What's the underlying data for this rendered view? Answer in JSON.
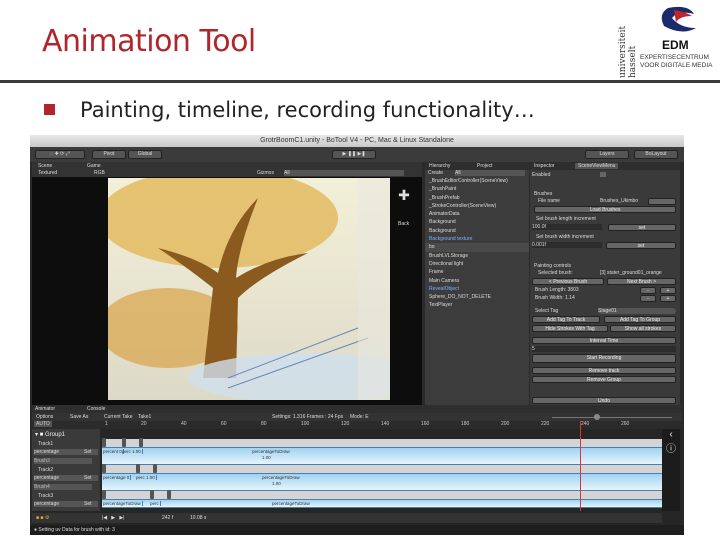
{
  "slide": {
    "title": "Animation Tool",
    "bullet": "Painting, timeline, recording functionality…",
    "logo": {
      "university": "universiteit hasselt",
      "edm": "EDM",
      "line1": "EXPERTISECENTRUM",
      "line2": "VOOR DIGITALE MEDIA"
    }
  },
  "window": {
    "title": "GrotrBoomC1.unity - BoTool V4 - PC, Mac & Linux Standalone",
    "toolbar": {
      "pivot": "Pivot",
      "global": "Global",
      "layers": "Layers",
      "layout": "BoLayout"
    },
    "scene": {
      "tab_scene": "Scene",
      "tab_game": "Game",
      "shading": "Textured",
      "mode": "RGB",
      "gizmos": "Gizmos",
      "search": "All",
      "back": "Back"
    },
    "hierarchy": {
      "tab": "Hierarchy",
      "tab_project": "Project",
      "create": "Create",
      "search": "All",
      "items": [
        "_BrushEditorController(SceneView)",
        "_BrushPaint",
        "_BrushPrefab",
        "_StrokeController(SceneView)",
        "AnimatorData",
        "Background",
        "Background",
        "Background texture",
        "bo",
        "BrushLVLStorage",
        "Directional light",
        "Frame",
        "Main Camera",
        "RevealObject",
        "Sphere_DO_NOT_DELETE",
        "TestPlayer"
      ]
    },
    "inspector": {
      "tab": "Inspector",
      "tab2": "SceneViewMenu",
      "enabled": "Enabled",
      "brushes": "Brushes",
      "file_name_label": "File name",
      "file_name": "Brushes_Ukimbo",
      "load": "Load Brushes",
      "len_label": "Set brush length increment",
      "len_value": "100.0f",
      "set": "set",
      "width_label": "Set brush width increment",
      "width_value": "0.001f",
      "painting": "Painting controls",
      "selected_label": "Selected brush:",
      "selected": "[3] stater_ground01_orange",
      "prev": "< Previous Brush",
      "next": "Next Brush >",
      "brush_length": "Brush Length: 3803",
      "brush_width": "Brush Width: 1.14",
      "minus": "-",
      "plus": "+",
      "select_tag": "Select Tag",
      "tag_value": "Stage01",
      "add_track": "Add Tag To Track",
      "add_group": "Add Tag To Group",
      "hide": "Hide Strokes With Tag",
      "show": "Show all strokes",
      "interval": "Interval Time",
      "interval_value": "5",
      "start": "Start Recording",
      "remove_track": "Remove track",
      "remove_group": "Remove Group",
      "undo": "Undo"
    },
    "animator": {
      "tab": "Animator",
      "tab_console": "Console",
      "menu": [
        "Options",
        "Save As",
        "Current Take",
        "Take1"
      ],
      "info": "Settings: 1.316 Frames : 24 Fps",
      "mode": "Mode: E",
      "auto": "AUTO",
      "ruler": [
        "1",
        "20",
        "40",
        "60",
        "80",
        "100",
        "120",
        "140",
        "160",
        "180",
        "200",
        "220",
        "240",
        "260"
      ],
      "group": "Group1",
      "tracks": [
        {
          "name": "Track1",
          "prop": "percentage",
          "set": "Set",
          "obj": "Brush3",
          "clips": [
            "percent 0",
            "perc 1.00"
          ],
          "long": "percentageToDraw",
          "long_val": "1.00"
        },
        {
          "name": "Track2",
          "prop": "percentage",
          "set": "Set",
          "obj": "Brush4",
          "clips": [
            "percentage 0",
            "perc 1.00"
          ],
          "long": "percentageToDraw",
          "long_val": "1.00"
        },
        {
          "name": "Track3",
          "prop": "percentage",
          "set": "Set",
          "obj": "",
          "clips": [
            "percentageToDraw",
            "perc"
          ],
          "long": "percentageToDraw",
          "long_val": ""
        }
      ],
      "frame": "242 f",
      "time": "10.08 s",
      "playhead": 240
    },
    "status": "Setting uv Data for brush with id: 3"
  }
}
